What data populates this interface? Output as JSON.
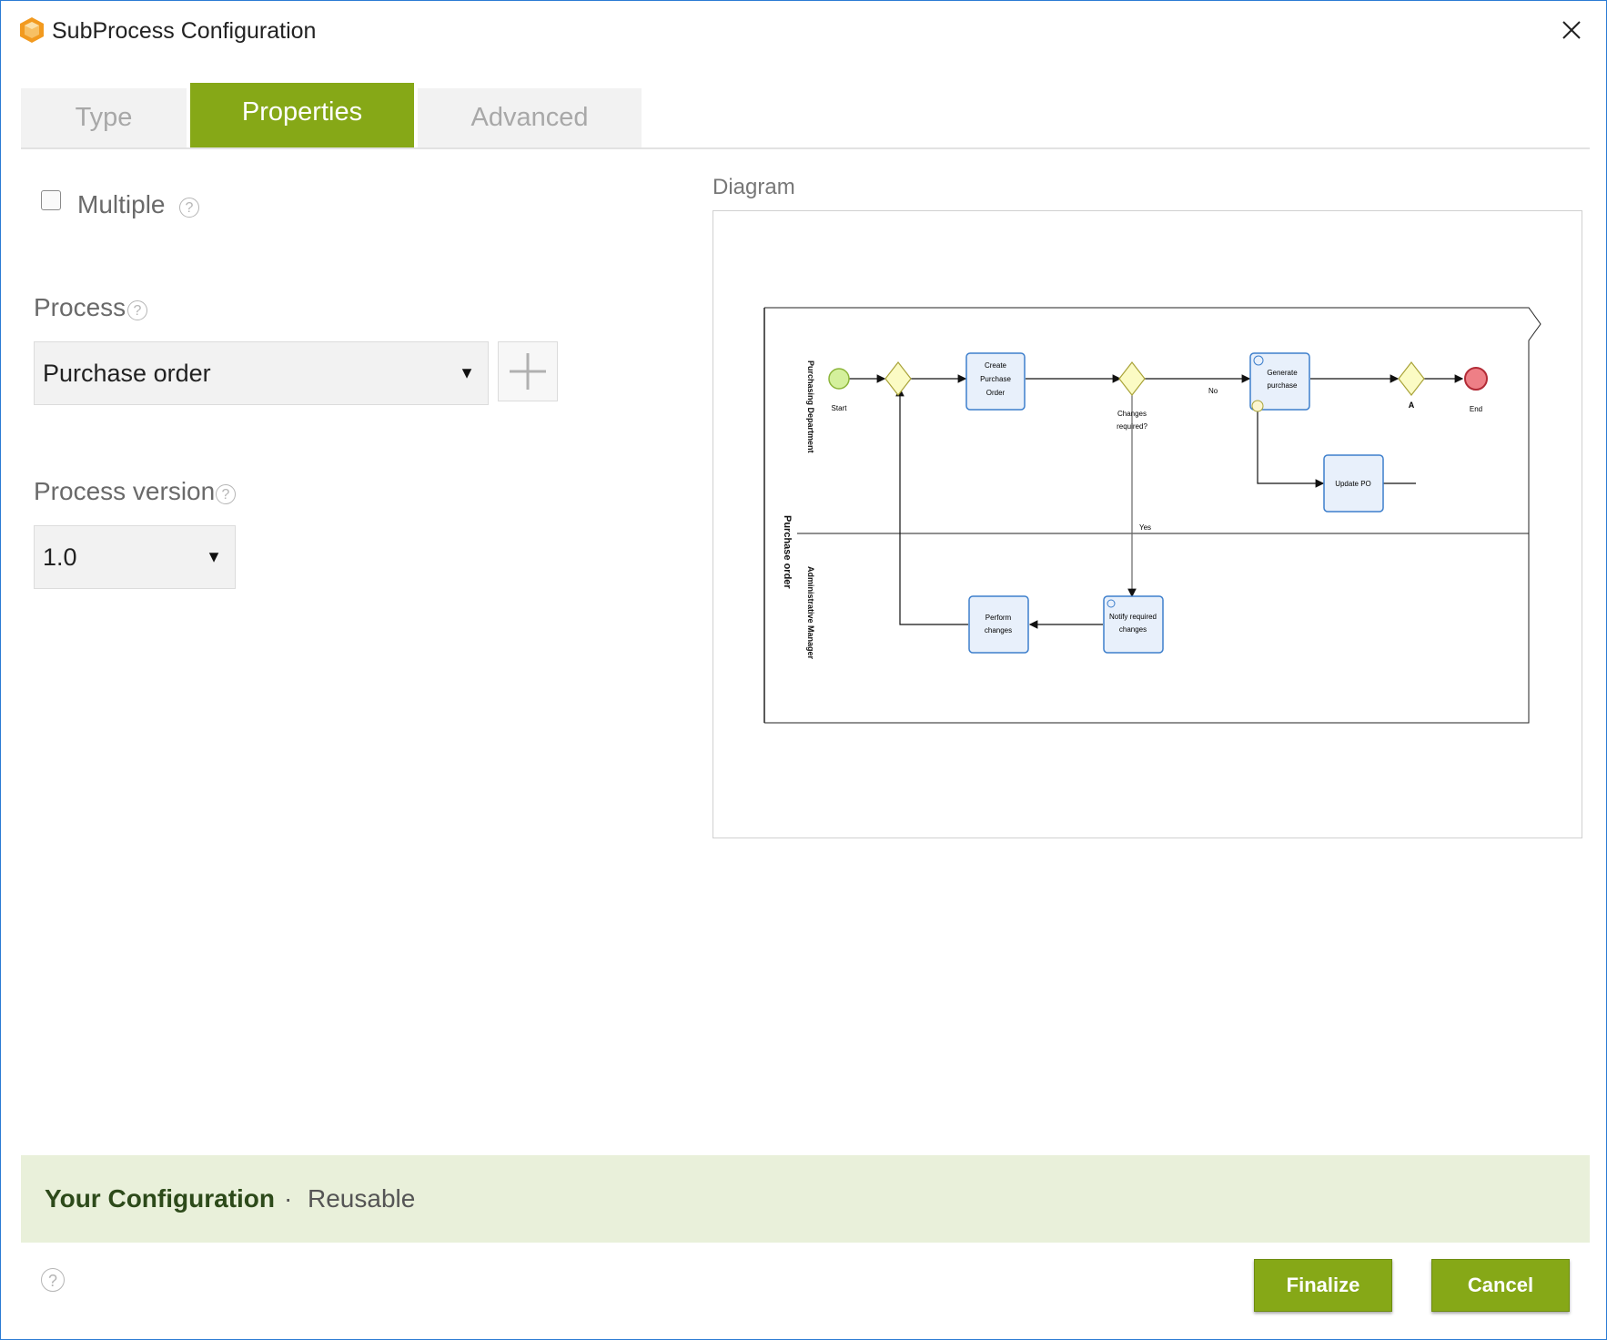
{
  "window": {
    "title": "SubProcess Configuration",
    "app_icon": "app-cube-icon",
    "close_icon": "close-icon"
  },
  "tabs": [
    {
      "label": "Type",
      "active": false
    },
    {
      "label": "Properties",
      "active": true
    },
    {
      "label": "Advanced",
      "active": false
    }
  ],
  "form": {
    "multiple_label": "Multiple",
    "multiple_checked": false,
    "process_label": "Process",
    "process_value": "Purchase order",
    "process_version_label": "Process version",
    "process_version_value": "1.0",
    "help_glyph": "?",
    "dropdown_glyph": "▼"
  },
  "diagram": {
    "label": "Diagram",
    "pool": "Purchase order",
    "lanes": [
      "Purchasing Department",
      "Administrative Manager"
    ],
    "nodes": {
      "start": "Start",
      "create_po": [
        "Create",
        "Purchase",
        "Order"
      ],
      "changes_required": [
        "Changes",
        "required?"
      ],
      "generate": [
        "Generate",
        "purchase"
      ],
      "update": "Update PO",
      "end": "End",
      "perform": [
        "Perform",
        "changes"
      ],
      "notify": [
        "Notify required",
        "changes"
      ],
      "gateway_a": "A"
    },
    "flows": {
      "no": "No",
      "yes": "Yes"
    }
  },
  "summary": {
    "key": "Your Configuration",
    "separator": "·",
    "value": "Reusable"
  },
  "footer": {
    "finalize": "Finalize",
    "cancel": "Cancel"
  },
  "colors": {
    "accent": "#86a817",
    "summary_bg": "#e9f0da",
    "task_fill": "#e8f0fb",
    "task_stroke": "#3d7fcc",
    "gateway_fill": "#fbfbc4",
    "start_fill": "#d4f09c",
    "end_fill": "#ee7f86"
  }
}
